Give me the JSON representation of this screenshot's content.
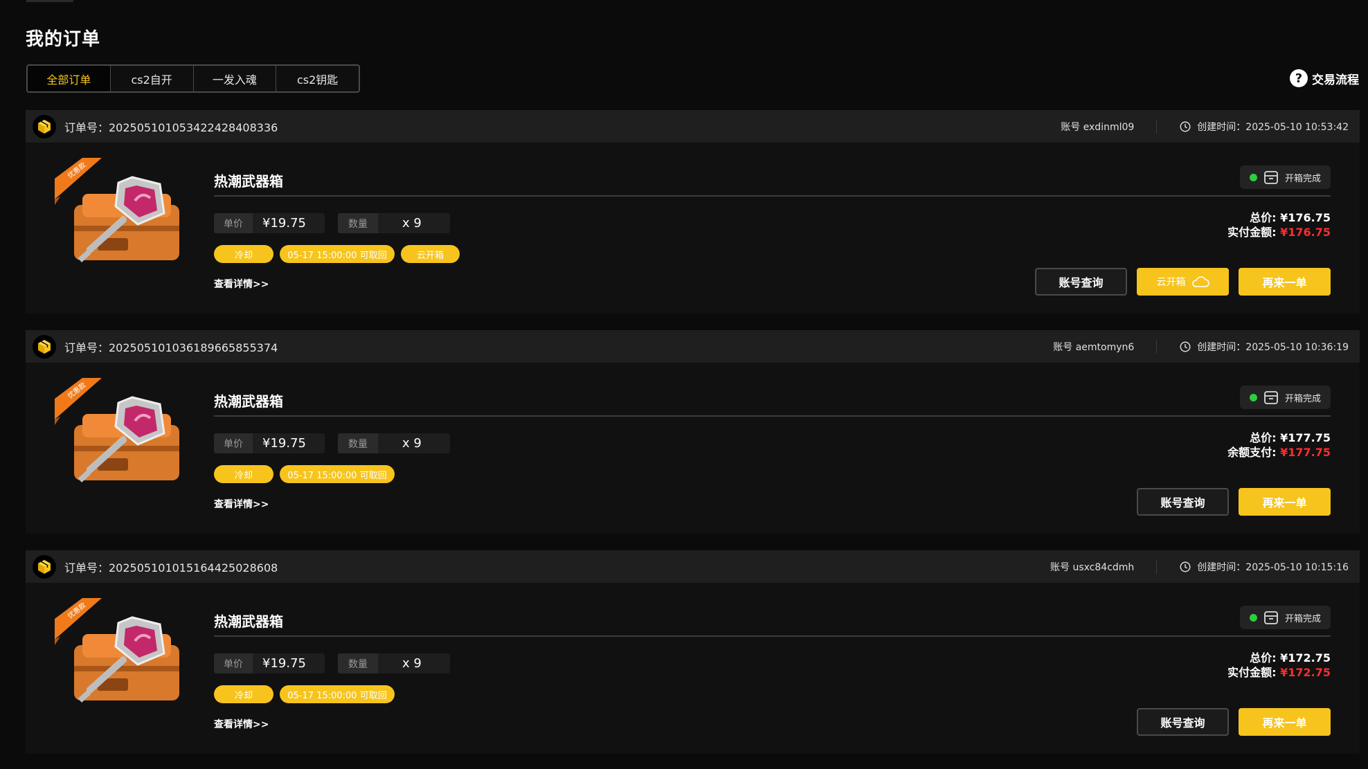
{
  "page": {
    "title": "我的订单"
  },
  "tabs": [
    {
      "label": "全部订单",
      "active": true
    },
    {
      "label": "cs2自开"
    },
    {
      "label": "一发入魂"
    },
    {
      "label": "cs2钥匙"
    }
  ],
  "process_link": {
    "icon": "question-icon",
    "label": "交易流程"
  },
  "colors": {
    "accent": "#f7c41d",
    "price_red": "#ff2e2e",
    "success": "#2ecc40"
  },
  "common": {
    "unit_price_label": "单价",
    "quantity_label": "数量",
    "detail_label": "查看详情>>",
    "account_query_label": "账号查询",
    "reorder_label": "再来一单",
    "cloud_open_label": "云开箱",
    "status_label": "开箱完成",
    "total_label": "总价:",
    "ribbon_text": "优惠款"
  },
  "orders": [
    {
      "order_no": "订单号：20250510105342242840833​6",
      "account": "账号 exdinml09",
      "created": "创建时间：2025-05-10 10:53:42",
      "product_name": "热潮武器箱",
      "unit_price": "¥19.75",
      "quantity": "x 9",
      "tags": [
        "冷却",
        "05-17 15:00:00 可取回",
        "云开箱"
      ],
      "total": "¥176.75",
      "paid_label": "实付金额:",
      "paid": "¥176.75",
      "show_cloud_button": true
    },
    {
      "order_no": "订单号：20250510103618966585537​4",
      "account": "账号 aemtomyn6",
      "created": "创建时间：2025-05-10 10:36:19",
      "product_name": "热潮武器箱",
      "unit_price": "¥19.75",
      "quantity": "x 9",
      "tags": [
        "冷却",
        "05-17 15:00:00 可取回"
      ],
      "total": "¥177.75",
      "paid_label": "余额支付:",
      "paid": "¥177.75",
      "show_cloud_button": false
    },
    {
      "order_no": "订单号：20250510101516442502860​8",
      "account": "账号 usxc84cdmh",
      "created": "创建时间：2025-05-10 10:15:16",
      "product_name": "热潮武器箱",
      "unit_price": "¥19.75",
      "quantity": "x 9",
      "tags": [
        "冷却",
        "05-17 15:00:00 可取回"
      ],
      "total": "¥172.75",
      "paid_label": "实付金额:",
      "paid": "¥172.75",
      "show_cloud_button": false
    }
  ]
}
